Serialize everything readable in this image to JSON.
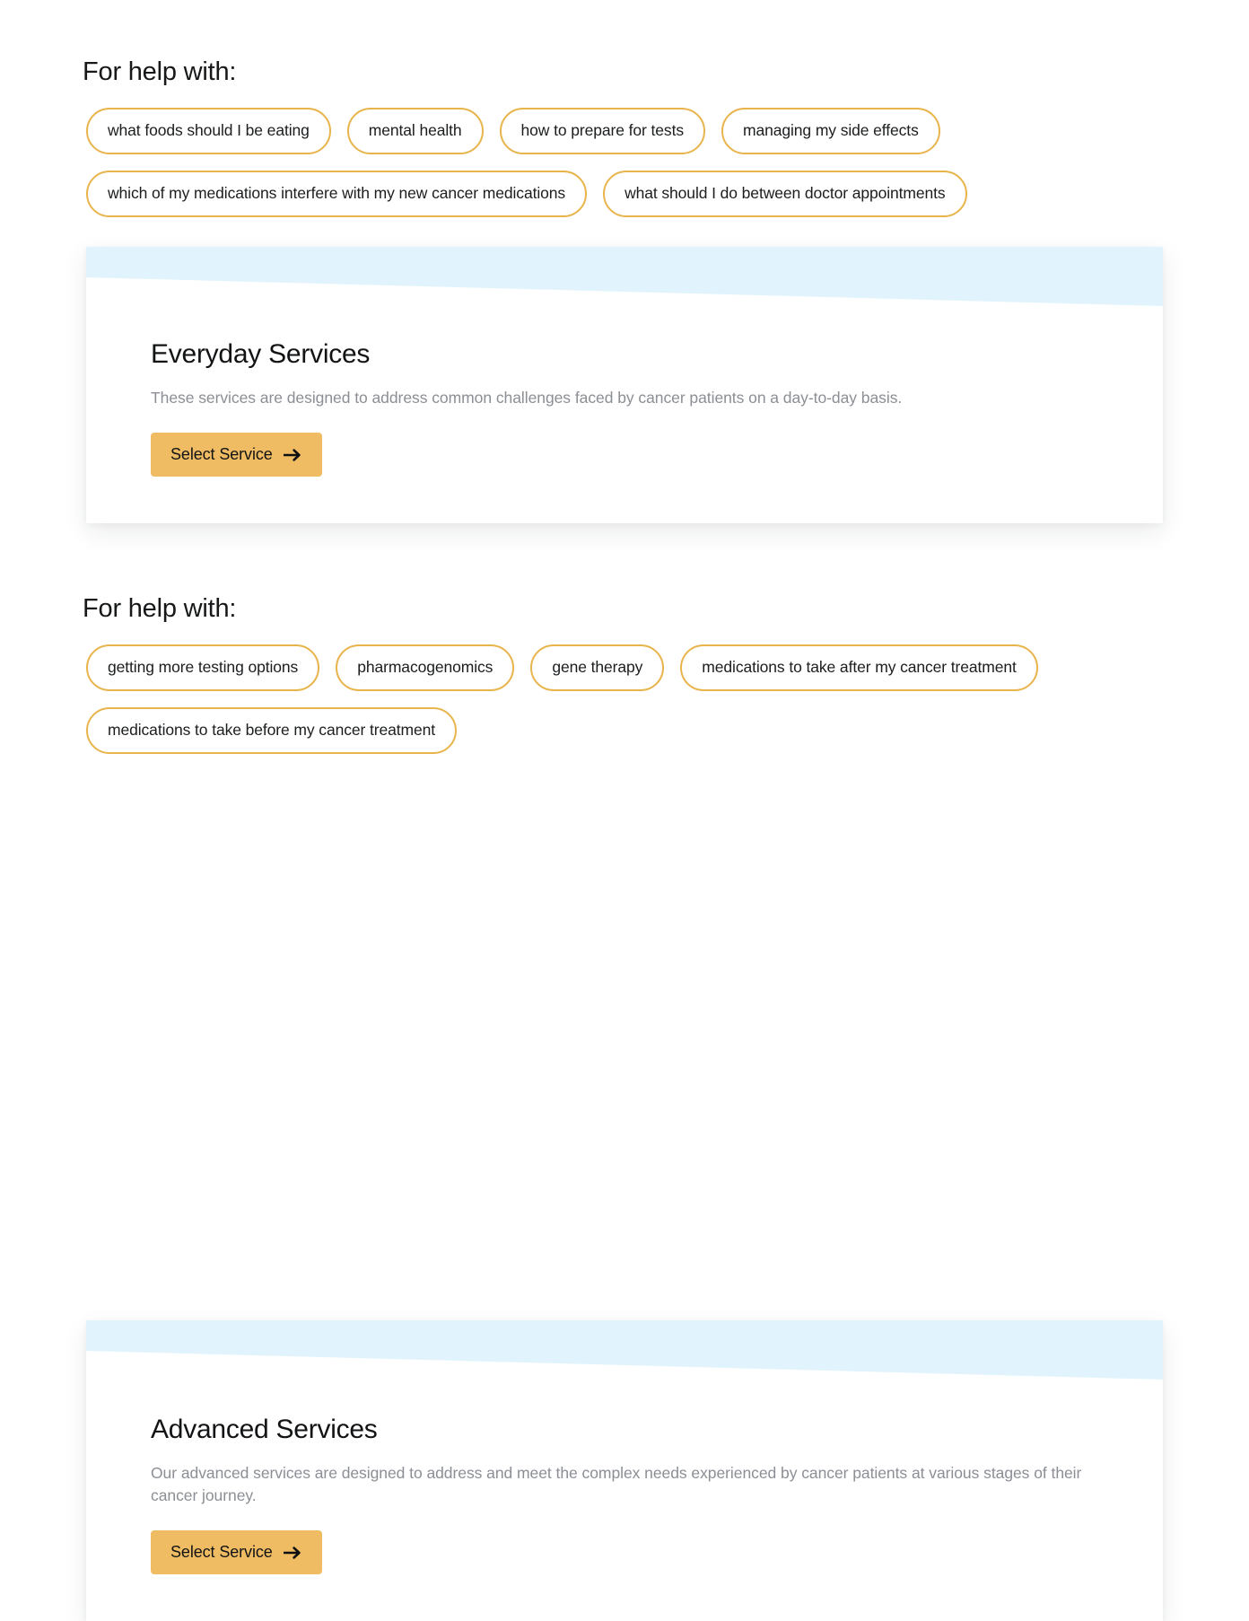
{
  "sections": [
    {
      "help_label": "For help with:",
      "pill_rows": [
        [
          "what foods should I be eating",
          "mental health",
          "how to prepare for tests",
          "managing my side effects"
        ],
        [
          "which of my medications interfere with my new cancer medications",
          "what should I do between doctor appointments"
        ]
      ],
      "card": {
        "title": "Everyday Services",
        "description": "These services are designed to address common challenges faced by cancer patients on a day-to-day basis.",
        "button_label": "Select Service",
        "button_icon": "arrow-right-icon"
      }
    },
    {
      "help_label": "For help with:",
      "pill_rows": [
        [
          "getting more testing options",
          "pharmacogenomics",
          "gene therapy",
          "medications to take after my cancer treatment"
        ],
        [
          "medications to take before my cancer treatment"
        ]
      ],
      "card": {
        "title": "Advanced Services",
        "description": "Our advanced services are designed to address and meet the complex needs experienced by cancer patients at various stages of their cancer journey.",
        "button_label": "Select Service",
        "button_icon": "arrow-right-icon"
      }
    }
  ],
  "colors": {
    "pill_border": "#e8b44c",
    "button_background": "#efbc63",
    "card_band": "#e1f4fd",
    "description_text": "#8b8f95",
    "page_background": "#ffffff"
  }
}
